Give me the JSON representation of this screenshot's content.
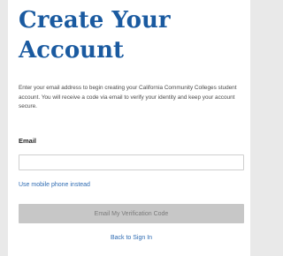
{
  "form": {
    "title": "Create Your Account",
    "intro": "Enter your email address to begin creating your California Community Colleges student account. You will receive a code via email to verify your identity and keep your account secure.",
    "email_label": "Email",
    "email_value": "",
    "email_placeholder": "",
    "use_phone_link": "Use mobile phone instead",
    "submit_label": "Email My Verification Code",
    "back_link": "Back to Sign In"
  },
  "colors": {
    "title": "#1a5aa0",
    "link": "#2f6cb3",
    "button_bg_disabled": "#c7c7c7",
    "button_text_disabled": "#7b7b7b",
    "page_bg": "#e9e9e9",
    "card_bg": "#ffffff"
  }
}
